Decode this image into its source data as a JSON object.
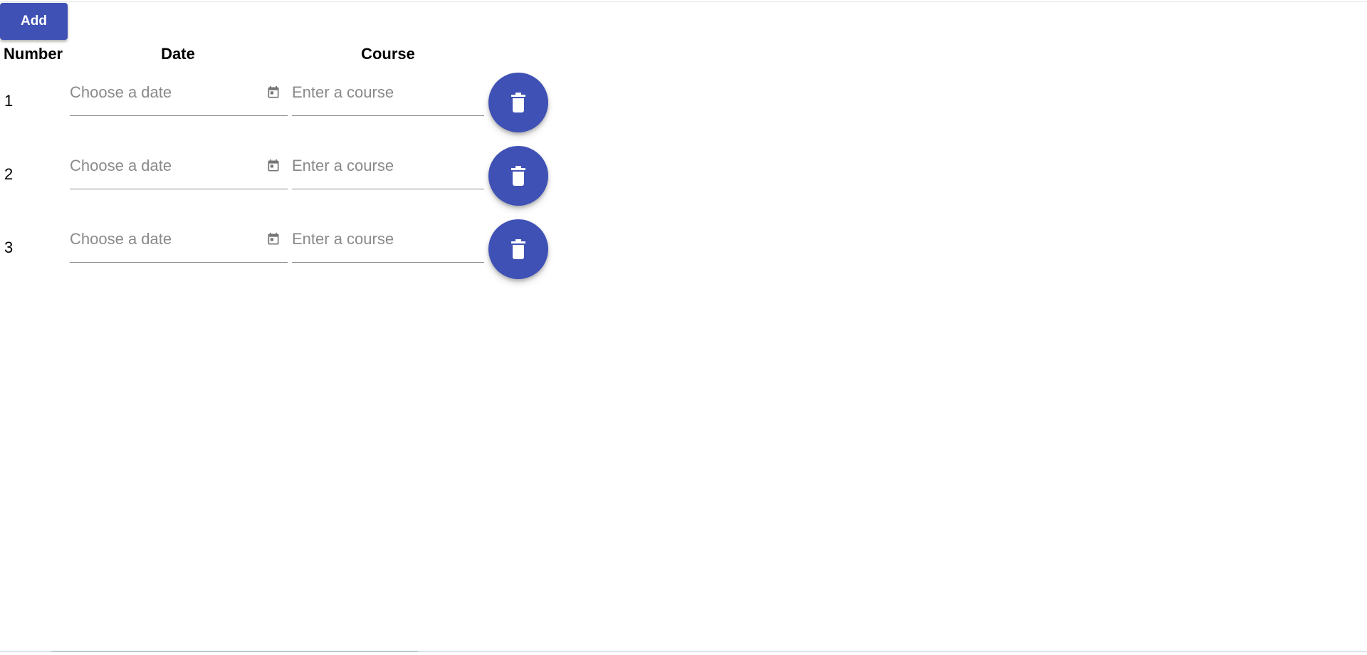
{
  "toolbar": {
    "add_label": "Add"
  },
  "table": {
    "headers": {
      "number": "Number",
      "date": "Date",
      "course": "Course"
    },
    "rows": [
      {
        "number": "1",
        "date_placeholder": "Choose a date",
        "course_placeholder": "Enter a course"
      },
      {
        "number": "2",
        "date_placeholder": "Choose a date",
        "course_placeholder": "Enter a course"
      },
      {
        "number": "3",
        "date_placeholder": "Choose a date",
        "course_placeholder": "Enter a course"
      }
    ]
  },
  "icons": {
    "calendar": "calendar-icon",
    "delete": "trash-icon"
  },
  "colors": {
    "accent": "#3f51b5",
    "icon_gray": "#757575",
    "underline": "#8a8a8a"
  }
}
